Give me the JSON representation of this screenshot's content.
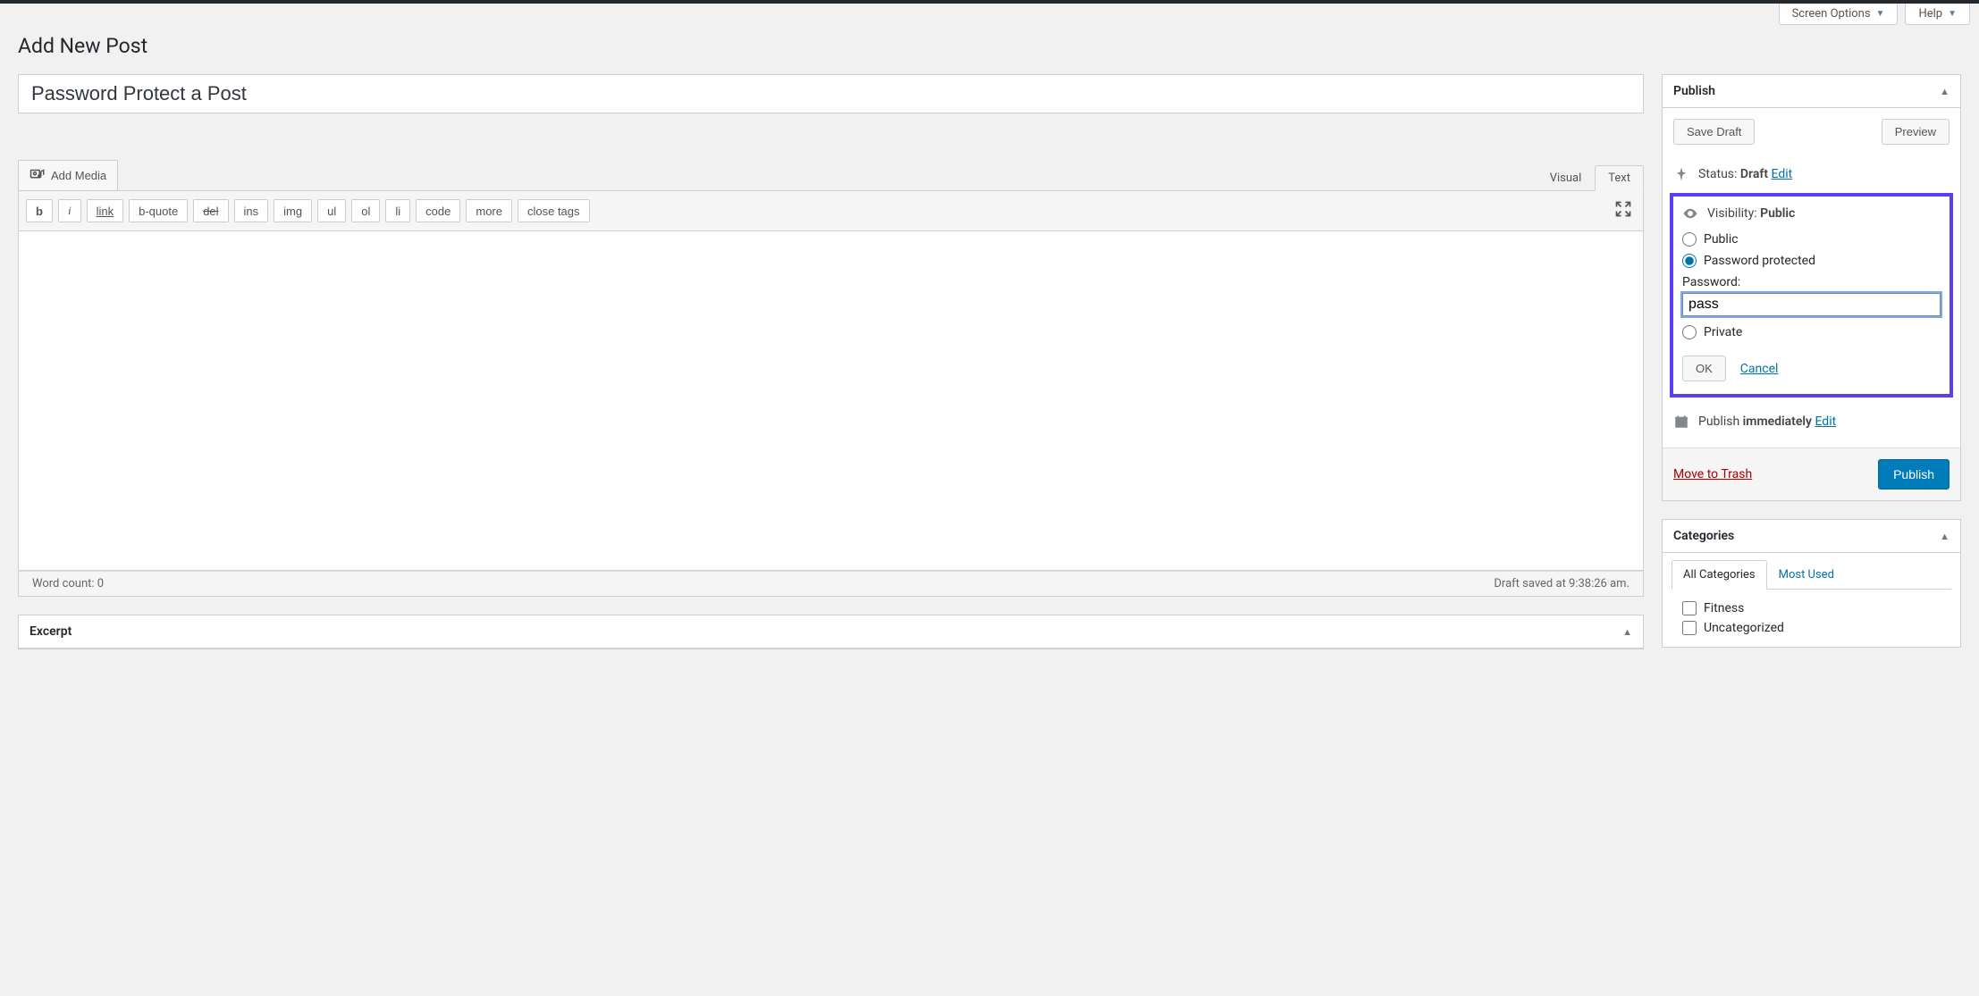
{
  "header": {
    "screen_options": "Screen Options",
    "help": "Help"
  },
  "page_title": "Add New Post",
  "post": {
    "title": "Password Protect a Post"
  },
  "media": {
    "add_media": "Add Media"
  },
  "editor": {
    "tabs": {
      "visual": "Visual",
      "text": "Text"
    },
    "toolbar": {
      "b": "b",
      "i": "i",
      "link": "link",
      "bquote": "b-quote",
      "del": "del",
      "ins": "ins",
      "img": "img",
      "ul": "ul",
      "ol": "ol",
      "li": "li",
      "code": "code",
      "more": "more",
      "close": "close tags"
    },
    "footer": {
      "wordcount_label": "Word count: ",
      "wordcount": "0",
      "saved": "Draft saved at 9:38:26 am."
    }
  },
  "excerpt": {
    "title": "Excerpt"
  },
  "publish": {
    "title": "Publish",
    "save_draft": "Save Draft",
    "preview": "Preview",
    "status_label": "Status: ",
    "status_value": "Draft",
    "edit": "Edit",
    "visibility_label": "Visibility: ",
    "visibility_value": "Public",
    "options": {
      "public": "Public",
      "password_protected": "Password protected",
      "private": "Private"
    },
    "password_label": "Password:",
    "password_value": "pass",
    "ok": "OK",
    "cancel": "Cancel",
    "schedule_label": "Publish ",
    "schedule_value": "immediately",
    "trash": "Move to Trash",
    "publish_btn": "Publish"
  },
  "categories": {
    "title": "Categories",
    "tabs": {
      "all": "All Categories",
      "most_used": "Most Used"
    },
    "items": [
      "Fitness",
      "Uncategorized"
    ]
  }
}
